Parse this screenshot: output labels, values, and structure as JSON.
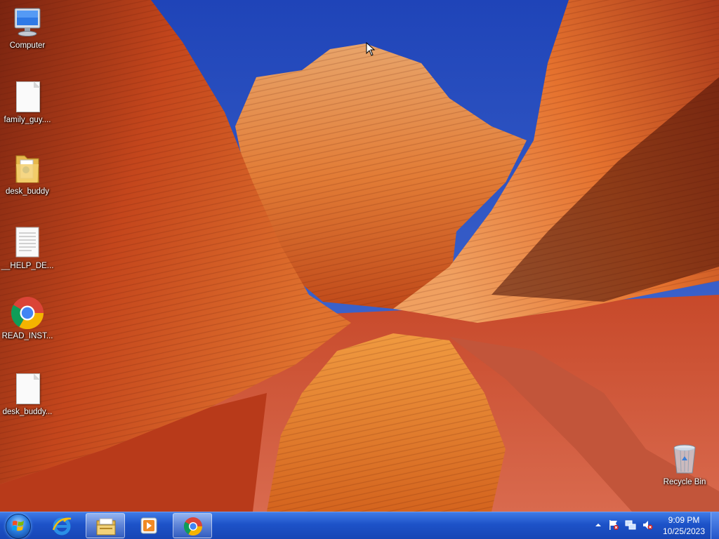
{
  "desktop": {
    "icons": [
      {
        "label": "Computer",
        "icon": "computer-icon"
      },
      {
        "label": "family_guy....",
        "icon": "document-icon"
      },
      {
        "label": "desk_buddy",
        "icon": "folder-icon"
      },
      {
        "label": "__HELP_DE...",
        "icon": "text-document-icon"
      },
      {
        "label": "READ_INST...",
        "icon": "chrome-icon"
      },
      {
        "label": "desk_buddy...",
        "icon": "document-icon"
      },
      {
        "label": "Recycle Bin",
        "icon": "recycle-bin-icon"
      }
    ]
  },
  "taskbar": {
    "start": {
      "icon": "windows-start-icon"
    },
    "pinned": [
      {
        "name": "Internet Explorer",
        "icon": "internet-explorer-icon"
      },
      {
        "name": "Windows Explorer",
        "icon": "file-explorer-icon"
      },
      {
        "name": "Windows Media Player",
        "icon": "media-player-icon"
      },
      {
        "name": "Google Chrome",
        "icon": "chrome-icon",
        "active": true
      }
    ],
    "tray": {
      "icons": [
        "show-hidden-icons-arrow",
        "action-center-flag-icon",
        "network-icon",
        "volume-muted-icon"
      ]
    },
    "clock": {
      "time": "9:09 PM",
      "date": "10/25/2023"
    }
  },
  "colors": {
    "taskbar": "#1d52c8",
    "sky": "#2a55c8",
    "rock": "#d0521f"
  }
}
